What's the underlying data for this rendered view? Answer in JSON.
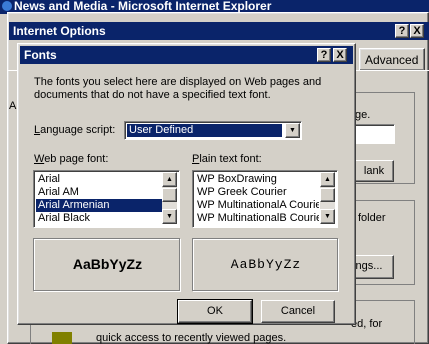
{
  "ie_window": {
    "title": "News and Media - Microsoft Internet Explorer"
  },
  "internet_options": {
    "title": "Internet Options",
    "help_btn": "?",
    "close_btn": "X",
    "tab_advanced": "Advanced",
    "bg_text_page": "ge.",
    "use_blank_label": "lank",
    "folder_text": "folder",
    "settings_label": "ngs...",
    "history_text": "ed, for",
    "history_desc": "quick access to recently viewed pages.",
    "left_fragment": "A"
  },
  "fonts_dialog": {
    "title": "Fonts",
    "help_btn": "?",
    "close_btn": "X",
    "description": "The fonts you select here are displayed on Web pages and documents that do not have a specified text font.",
    "language_script": {
      "label_pre": "L",
      "label_rest": "anguage script:",
      "value": "User Defined"
    },
    "web_page_font": {
      "label_pre": "W",
      "label_rest": "eb page font:",
      "items": [
        "Arial",
        "Arial AM",
        "Arial Armenian",
        "Arial Black"
      ],
      "selected_index": 2,
      "preview": "AaBbYyZz"
    },
    "plain_text_font": {
      "label_pre": "P",
      "label_rest": "lain text font:",
      "items": [
        "WP BoxDrawing",
        "WP Greek Courier",
        "WP MultinationalA Courier",
        "WP MultinationalB Courier"
      ],
      "preview": "AaBbYyZz"
    },
    "ok_label": "OK",
    "cancel_label": "Cancel"
  }
}
